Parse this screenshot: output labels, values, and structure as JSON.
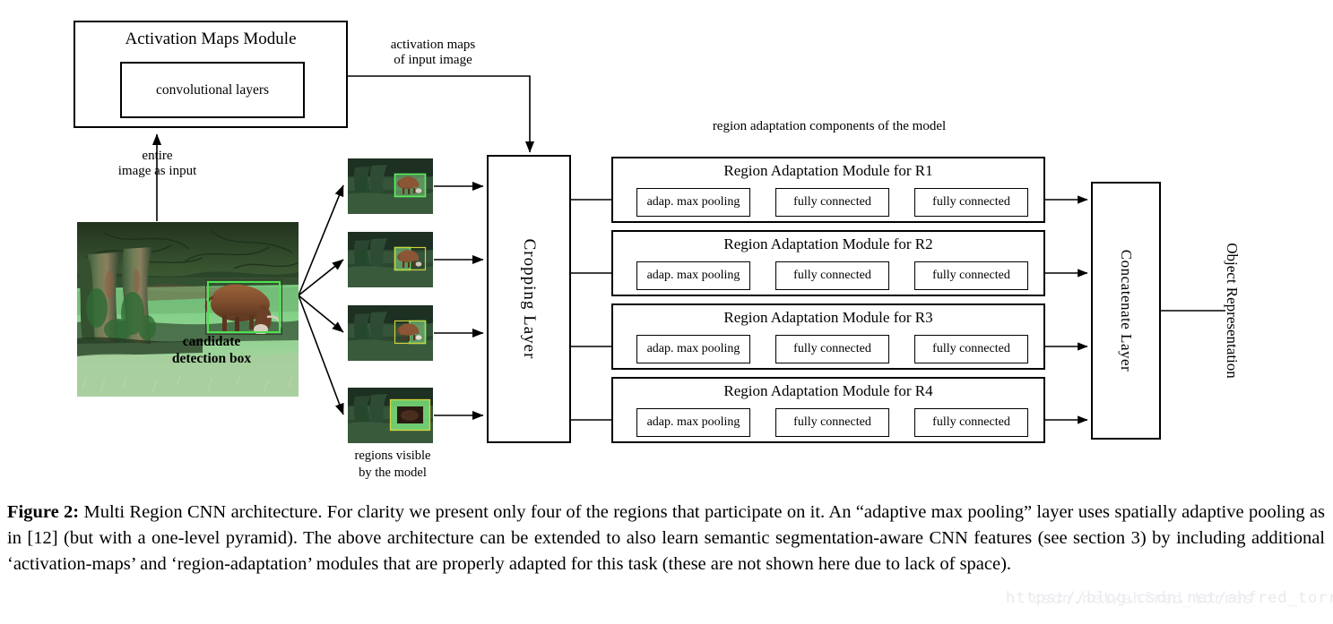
{
  "figure": {
    "label": "Figure 2:",
    "caption": "Multi Region CNN architecture. For clarity we present only four of the regions that participate on it. An “adaptive max pooling” layer uses spatially adaptive pooling as in [12] (but with a one-level pyramid). The above architecture can be extended to also learn semantic segmentation-aware CNN features (see section 3) by including additional ‘activation-maps’ and ‘region-adaptation’ modules that are properly adapted for this task (these are not shown here due to lack of space)."
  },
  "watermark": {
    "text": "https://blog.csdn.net/ahfred_torres",
    "overlay": "csdn.net/ahfred_torres"
  },
  "activation_module": {
    "title": "Activation Maps Module",
    "inner_label": "convolutional layers"
  },
  "edges": {
    "entire_image_as_input": "entire\nimage as input",
    "activation_maps_of_input_image": "activation maps\nof input image"
  },
  "input_image": {
    "candidate_box_label": "candidate\ndetection box",
    "alt": "photograph of a highland cow grazing on green grass beside mossy tree trunks"
  },
  "thumbnails": {
    "caption": "regions visible\nby the model",
    "items": [
      {
        "region": "R1",
        "highlight": "full-box"
      },
      {
        "region": "R2",
        "highlight": "left-half"
      },
      {
        "region": "R3",
        "highlight": "right-half"
      },
      {
        "region": "R4",
        "highlight": "border-ring"
      }
    ]
  },
  "cropping_layer": {
    "label": "Cropping Layer"
  },
  "region_adaptation": {
    "group_label": "region adaptation components of the model",
    "modules": [
      {
        "title": "Region Adaptation Module for R1",
        "stages": [
          "adap. max pooling",
          "fully connected",
          "fully connected"
        ]
      },
      {
        "title": "Region Adaptation Module for R2",
        "stages": [
          "adap. max pooling",
          "fully connected",
          "fully connected"
        ]
      },
      {
        "title": "Region Adaptation Module for R3",
        "stages": [
          "adap. max pooling",
          "fully connected",
          "fully connected"
        ]
      },
      {
        "title": "Region Adaptation Module for R4",
        "stages": [
          "adap. max pooling",
          "fully connected",
          "fully connected"
        ]
      }
    ]
  },
  "concatenate_layer": {
    "label": "Concatenate Layer"
  },
  "output": {
    "label": "Object Representation"
  },
  "colors": {
    "stroke": "#000000",
    "highlight_green": "#4ee24e",
    "photo_grass": "#7fc982",
    "photo_bark": "#2e4a33",
    "cow_brown": "#8b5a3c"
  }
}
